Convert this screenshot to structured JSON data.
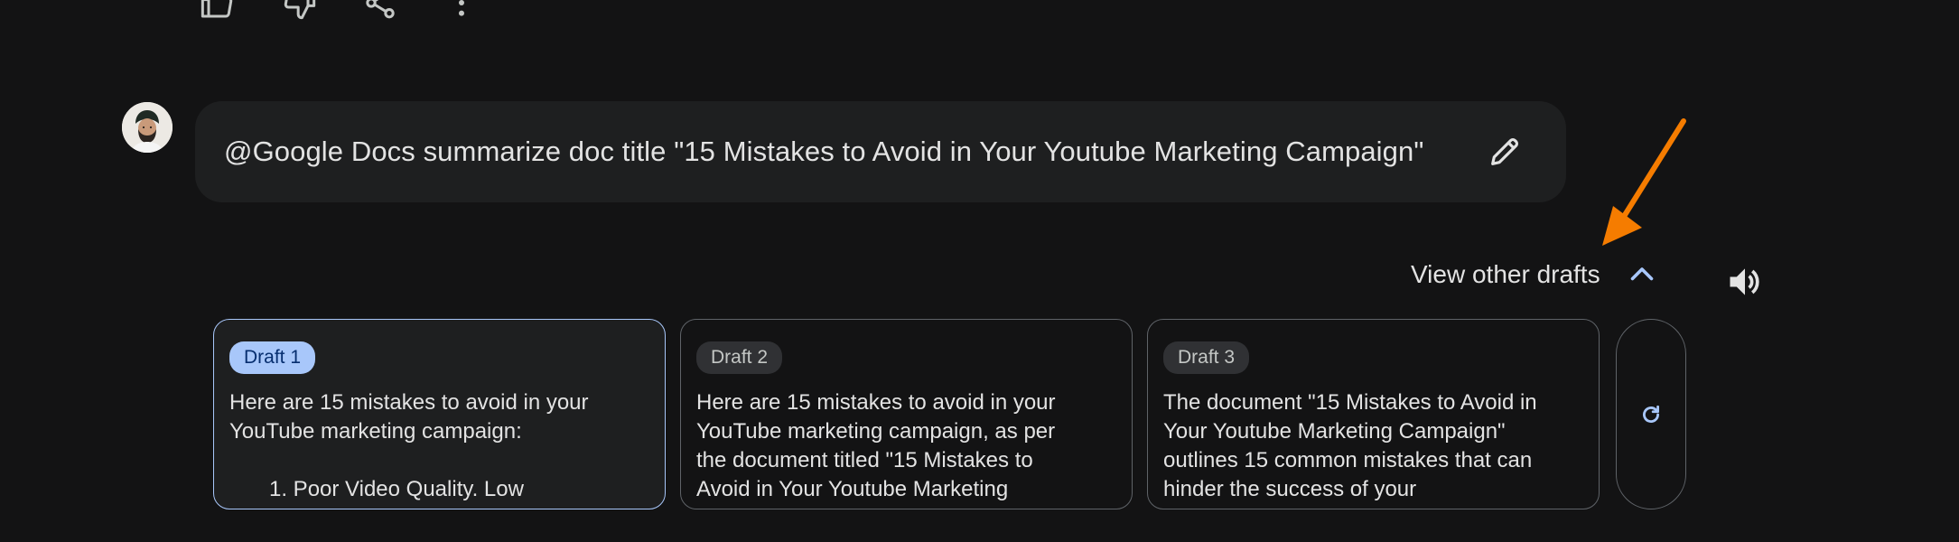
{
  "response_actions": {
    "icons": [
      "thumbs-up-icon",
      "thumbs-down-icon",
      "share-icon",
      "more-vert-icon"
    ]
  },
  "user": {
    "avatar_icon": "user-avatar"
  },
  "prompt": {
    "text": "@Google Docs summarize doc title \"15 Mistakes to Avoid in Your Youtube Marketing Campaign\"",
    "edit_icon": "pencil-icon"
  },
  "drafts_toggle": {
    "label": "View other drafts",
    "chevron_icon": "chevron-up-icon",
    "speaker_icon": "volume-icon"
  },
  "drafts": [
    {
      "chip": "Draft 1",
      "selected": true,
      "text": "Here are 15 mistakes to avoid in your YouTube marketing campaign:",
      "list_first": "1. Poor Video Quality. Low"
    },
    {
      "chip": "Draft 2",
      "selected": false,
      "text": "Here are 15 mistakes to avoid in your YouTube marketing campaign, as per the document titled \"15 Mistakes to Avoid in Your Youtube Marketing"
    },
    {
      "chip": "Draft 3",
      "selected": false,
      "text": "The document \"15 Mistakes to Avoid in Your Youtube Marketing Campaign\" outlines 15 common mistakes that can hinder the success of your"
    }
  ],
  "regenerate": {
    "icon": "refresh-icon"
  },
  "colors": {
    "background": "#131314",
    "bubble": "#1e1f20",
    "accent": "#a8c7fa",
    "annotation": "#f57c00"
  }
}
